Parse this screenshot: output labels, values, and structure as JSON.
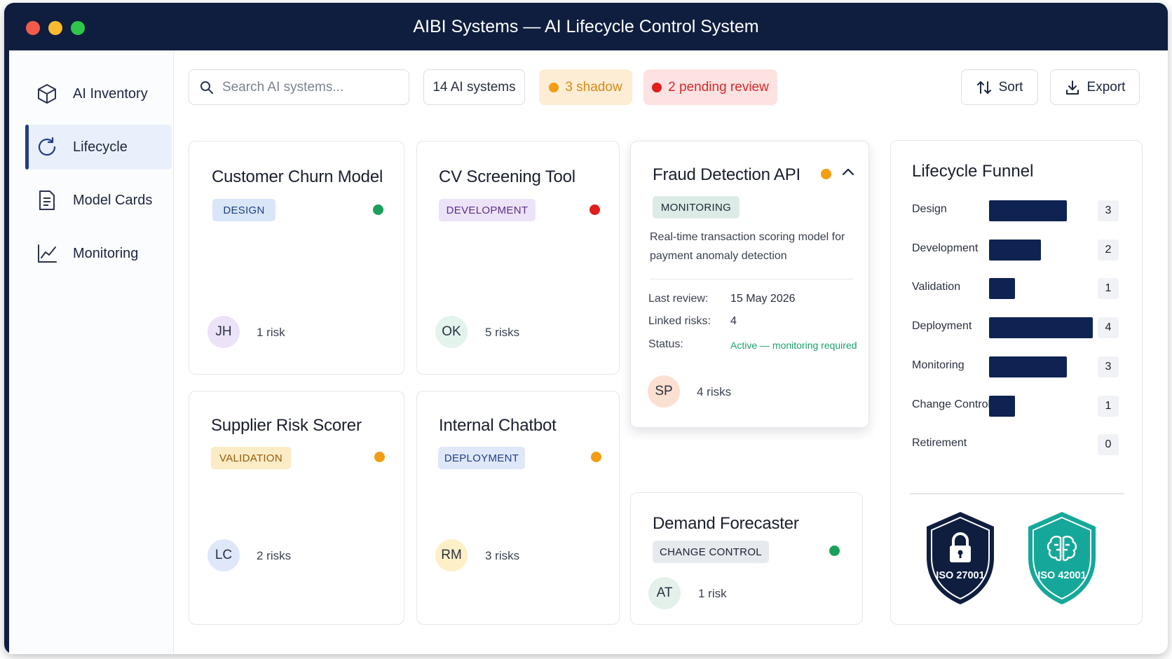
{
  "window": {
    "title": "AIBI Systems — AI Lifecycle Control System"
  },
  "sidebar": {
    "items": [
      {
        "label": "AI Inventory",
        "icon": "cube-icon"
      },
      {
        "label": "Lifecycle",
        "icon": "refresh-icon",
        "active": true
      },
      {
        "label": "Model Cards",
        "icon": "document-icon"
      },
      {
        "label": "Monitoring",
        "icon": "line-chart-icon"
      }
    ]
  },
  "toolbar": {
    "search_placeholder": "Search AI systems...",
    "count_label": "14 AI systems",
    "shadow_label": "3 shadow",
    "pending_label": "2 pending review",
    "sort_label": "Sort",
    "export_label": "Export"
  },
  "colors": {
    "navy": "#0f1e3f",
    "status_green": "#1aa05a",
    "status_red": "#e11d1d",
    "status_orange": "#f29d12"
  },
  "cards": {
    "churn": {
      "title": "Customer Churn Model",
      "stage": "DESIGN",
      "status": "green",
      "initials": "JH",
      "risks": "1 risk"
    },
    "cv": {
      "title": "CV Screening Tool",
      "stage": "DEVELOPMENT",
      "status": "red",
      "initials": "OK",
      "risks": "5 risks"
    },
    "fraud": {
      "title": "Fraud Detection API",
      "stage": "MONITORING",
      "status": "orange",
      "description": "Real-time transaction scoring model for payment anomaly detection",
      "last_review_label": "Last review:",
      "last_review": "15 May 2026",
      "linked_risks_label": "Linked risks:",
      "linked_risks": "4",
      "status_label": "Status:",
      "status_text": "Active — monitoring required",
      "initials": "SP",
      "risks": "4 risks"
    },
    "supplier": {
      "title": "Supplier Risk Scorer",
      "stage": "VALIDATION",
      "status": "orange",
      "initials": "LC",
      "risks": "2 risks"
    },
    "chatbot": {
      "title": "Internal Chatbot",
      "stage": "DEPLOYMENT",
      "status": "orange",
      "initials": "RM",
      "risks": "3 risks"
    },
    "demand": {
      "title": "Demand Forecaster",
      "stage": "CHANGE CONTROL",
      "status": "green",
      "initials": "AT",
      "risks": "1 risk"
    }
  },
  "funnel": {
    "title": "Lifecycle Funnel",
    "rows": [
      {
        "label": "Design",
        "value": 3
      },
      {
        "label": "Development",
        "value": 2
      },
      {
        "label": "Validation",
        "value": 1
      },
      {
        "label": "Deployment",
        "value": 4
      },
      {
        "label": "Monitoring",
        "value": 3
      },
      {
        "label": "Change Control",
        "value": 1
      },
      {
        "label": "Retirement",
        "value": 0
      }
    ],
    "badges": [
      "ISO 27001",
      "ISO 42001"
    ]
  }
}
